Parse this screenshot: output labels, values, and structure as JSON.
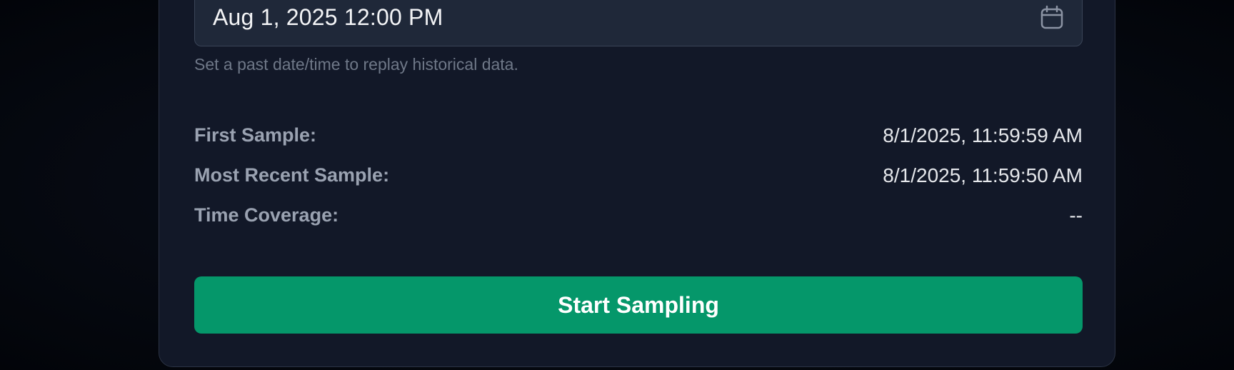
{
  "datetime": {
    "value": "Aug 1, 2025 12:00 PM",
    "icon": "calendar-icon",
    "helper": "Set a past date/time to replay historical data."
  },
  "info": {
    "first_label": "First Sample:",
    "first_value": "8/1/2025, 11:59:59 AM",
    "recent_label": "Most Recent Sample:",
    "recent_value": "8/1/2025, 11:59:50 AM",
    "coverage_label": "Time Coverage:",
    "coverage_value": "--"
  },
  "actions": {
    "start_label": "Start Sampling"
  },
  "colors": {
    "accent": "#05976a",
    "card_bg": "#121828",
    "page_bg": "#05080f"
  }
}
